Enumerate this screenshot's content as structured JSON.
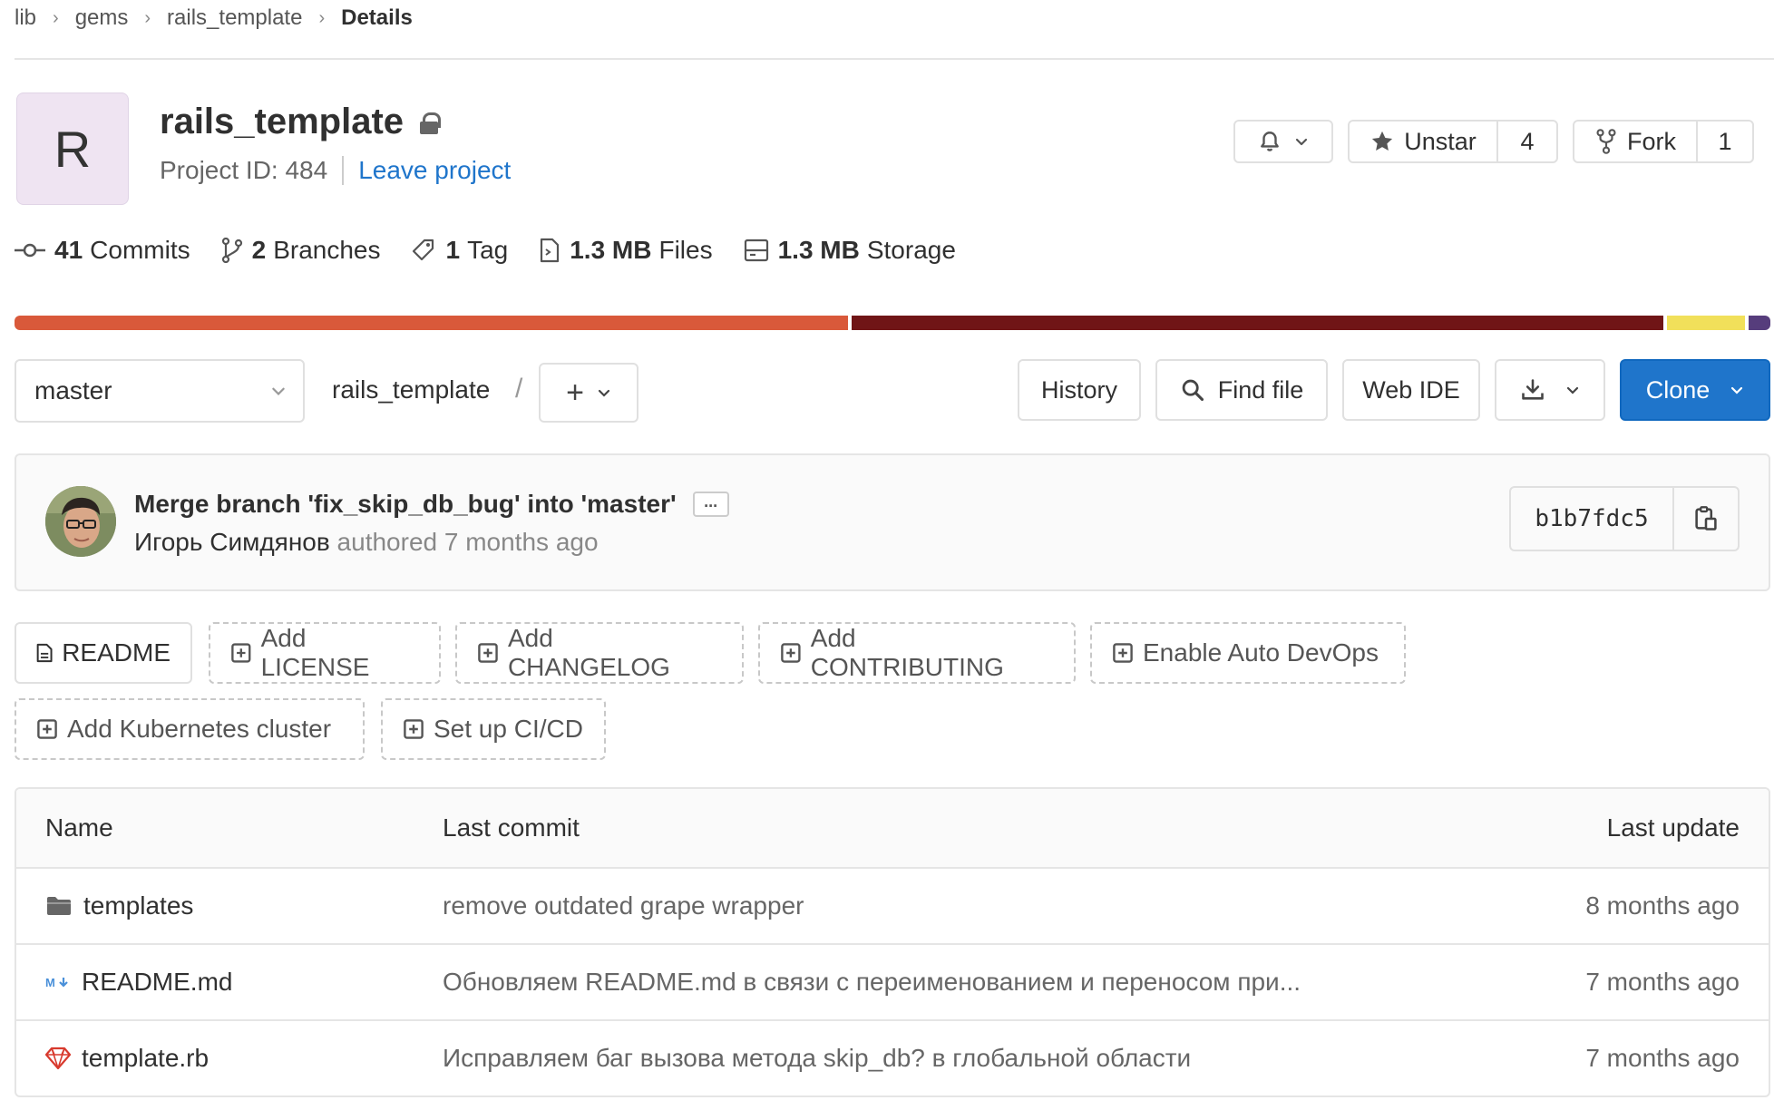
{
  "breadcrumb": {
    "items": [
      "lib",
      "gems",
      "rails_template"
    ],
    "current": "Details"
  },
  "project": {
    "avatar_letter": "R",
    "name": "rails_template",
    "id_text": "Project ID: 484",
    "leave_label": "Leave project"
  },
  "actions": {
    "unstar_label": "Unstar",
    "star_count": "4",
    "fork_label": "Fork",
    "fork_count": "1"
  },
  "stats": {
    "commits_count": "41",
    "commits_label": "Commits",
    "branches_count": "2",
    "branches_label": "Branches",
    "tags_count": "1",
    "tags_label": "Tag",
    "files_size": "1.3 MB",
    "files_label": "Files",
    "storage_size": "1.3 MB",
    "storage_label": "Storage"
  },
  "languages": [
    {
      "share": 47.6,
      "color": "#d9593a"
    },
    {
      "share": 46.4,
      "color": "#701516"
    },
    {
      "share": 4.6,
      "color": "#f1e05a"
    },
    {
      "share": 1.4,
      "color": "#563d7c"
    }
  ],
  "toolbar": {
    "branch": "master",
    "path": "rails_template",
    "path_separator": "/",
    "add_symbol": "+",
    "history_label": "History",
    "find_file_label": "Find file",
    "web_ide_label": "Web IDE",
    "clone_label": "Clone"
  },
  "last_commit": {
    "title": "Merge branch 'fix_skip_db_bug' into 'master'",
    "ellipsis": "...",
    "author": "Игорь Симдянов",
    "authored_text": "authored 7 months ago",
    "sha": "b1b7fdc5"
  },
  "quick_actions": {
    "readme": "README",
    "add_license": "Add LICENSE",
    "add_changelog": "Add CHANGELOG",
    "add_contributing": "Add CONTRIBUTING",
    "enable_devops": "Enable Auto DevOps",
    "add_k8s": "Add Kubernetes cluster",
    "setup_cicd": "Set up CI/CD"
  },
  "file_table": {
    "headers": {
      "name": "Name",
      "last_commit": "Last commit",
      "last_update": "Last update"
    },
    "rows": [
      {
        "name": "templates",
        "commit": "remove outdated grape wrapper",
        "updated": "8 months ago"
      },
      {
        "name": "README.md",
        "commit": "Обновляем README.md в связи с переименованием и переносом при...",
        "updated": "7 months ago"
      },
      {
        "name": "template.rb",
        "commit": "Исправляем баг вызова метода skip_db? в глобальной области",
        "updated": "7 months ago"
      }
    ]
  },
  "colors": {
    "accent": "#1f75cb",
    "border": "#e0e0e0",
    "text": "#303030",
    "muted": "#666666"
  },
  "icons": [
    "bell-icon",
    "star-icon",
    "fork-icon",
    "commit-icon",
    "branch-icon",
    "tag-icon",
    "file-icon",
    "storage-icon",
    "search-icon",
    "download-icon",
    "copy-icon",
    "folder-icon",
    "markdown-icon",
    "ruby-icon",
    "plus-square-icon",
    "chevron-down-icon",
    "lock-icon"
  ]
}
